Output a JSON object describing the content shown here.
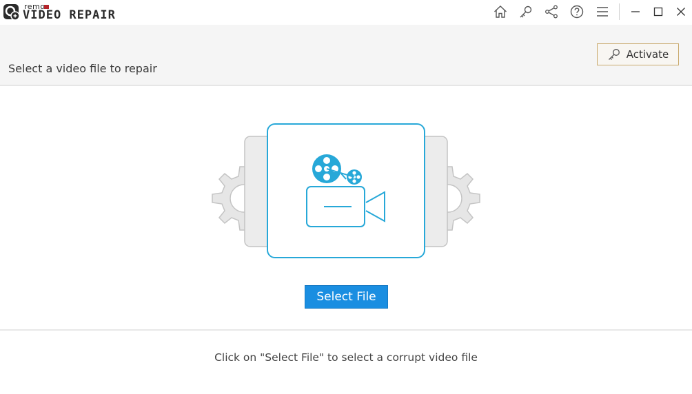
{
  "app": {
    "logo_small": "remo",
    "logo_name": "VIDEO REPAIR"
  },
  "toolbar": {
    "icons": [
      "home-icon",
      "key-icon",
      "share-icon",
      "help-icon",
      "menu-icon"
    ],
    "window_controls": [
      "minimize-icon",
      "maximize-icon",
      "close-icon"
    ]
  },
  "header": {
    "title": "Select a video file to repair",
    "activate_label": "Activate"
  },
  "main": {
    "select_button_label": "Select File",
    "hint": "Click on \"Select File\" to select a corrupt video file"
  },
  "colors": {
    "accent": "#1a8ee1",
    "icon_blue": "#27a8d8",
    "activate_border": "#c9a96b",
    "logo_red": "#b5252b"
  }
}
